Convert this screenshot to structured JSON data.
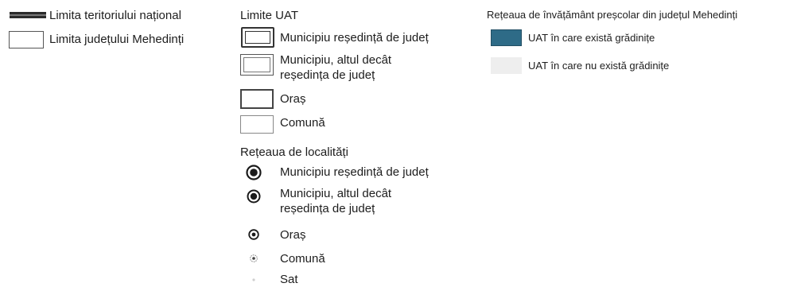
{
  "borders": {
    "national": "Limita teritoriului național",
    "county": "Limita județului Mehedinți"
  },
  "uat": {
    "heading": "Limite UAT",
    "items": [
      {
        "label": "Municipiu reședință de județ"
      },
      {
        "label_line1": "Municipiu, altul decât",
        "label_line2": "reședința de județ"
      },
      {
        "label": "Oraș"
      },
      {
        "label": "Comună"
      }
    ]
  },
  "localities": {
    "heading": "Rețeaua de localități",
    "items": [
      {
        "label": "Municipiu reședință de județ"
      },
      {
        "label_line1": "Municipiu, altul decât",
        "label_line2": "reședința de județ"
      },
      {
        "label": "Oraș"
      },
      {
        "label": "Comună"
      },
      {
        "label": "Sat"
      }
    ]
  },
  "network": {
    "heading": "Rețeaua de învățământ preșcolar din județul Mehedinți",
    "items": [
      {
        "label": "UAT în care există grădinițe",
        "color": "#2e6b87"
      },
      {
        "label": "UAT în care nu există grădinițe",
        "color": "#eeeeee"
      }
    ]
  }
}
